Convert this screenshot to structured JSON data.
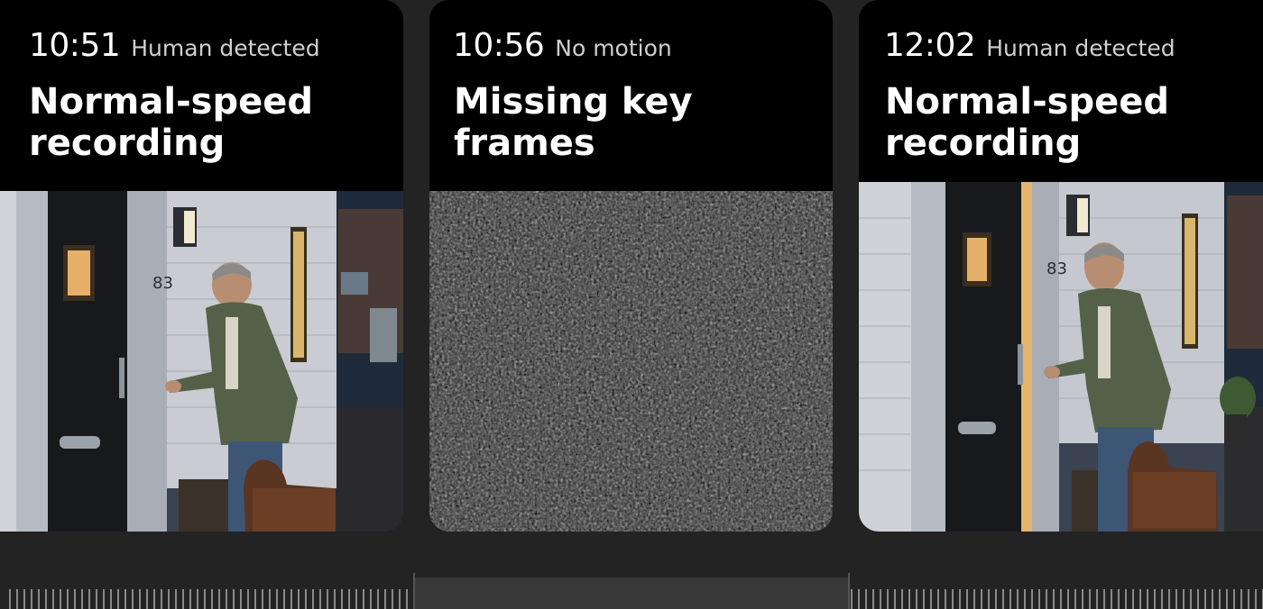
{
  "clips": [
    {
      "time": "10:51",
      "event": "Human detected",
      "title": "Normal-speed recording"
    },
    {
      "time": "10:56",
      "event": "No motion",
      "title": "Missing key frames"
    },
    {
      "time": "12:02",
      "event": "Human detected",
      "title": "Normal-speed recording"
    }
  ],
  "house_number": "83",
  "colors": {
    "background": "#232323",
    "card": "#000000",
    "gap_bar": "#383838"
  }
}
